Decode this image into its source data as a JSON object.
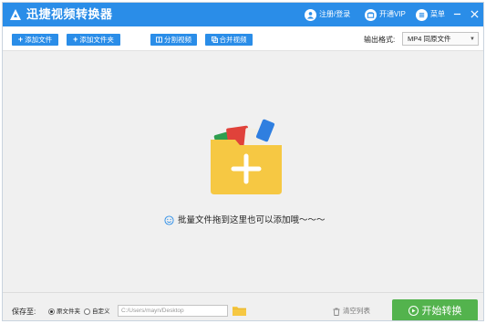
{
  "app": {
    "title": "迅捷视频转换器"
  },
  "titlebar": {
    "login": "注册/登录",
    "vip": "开通VIP",
    "menu": "菜单"
  },
  "toolbar": {
    "add_file": "添加文件",
    "add_folder": "添加文件夹",
    "split_video": "分割视频",
    "merge_video": "合并视频",
    "format_label": "输出格式:",
    "format_value": "MP4 同原文件"
  },
  "dropzone": {
    "hint": "批量文件拖到这里也可以添加哦～～～"
  },
  "bottom": {
    "save_label": "保存至:",
    "radio_original": "原文件夹",
    "radio_custom": "自定义",
    "path_value": "C:/Users/mayn/Desktop",
    "clear_list": "清空列表",
    "start": "开始转换"
  },
  "colors": {
    "titlebar": "#2a8de8",
    "primary_button": "#2a8de8",
    "start_button": "#53b34d",
    "folder": "#f6c843",
    "background": "#f0f0f0"
  }
}
